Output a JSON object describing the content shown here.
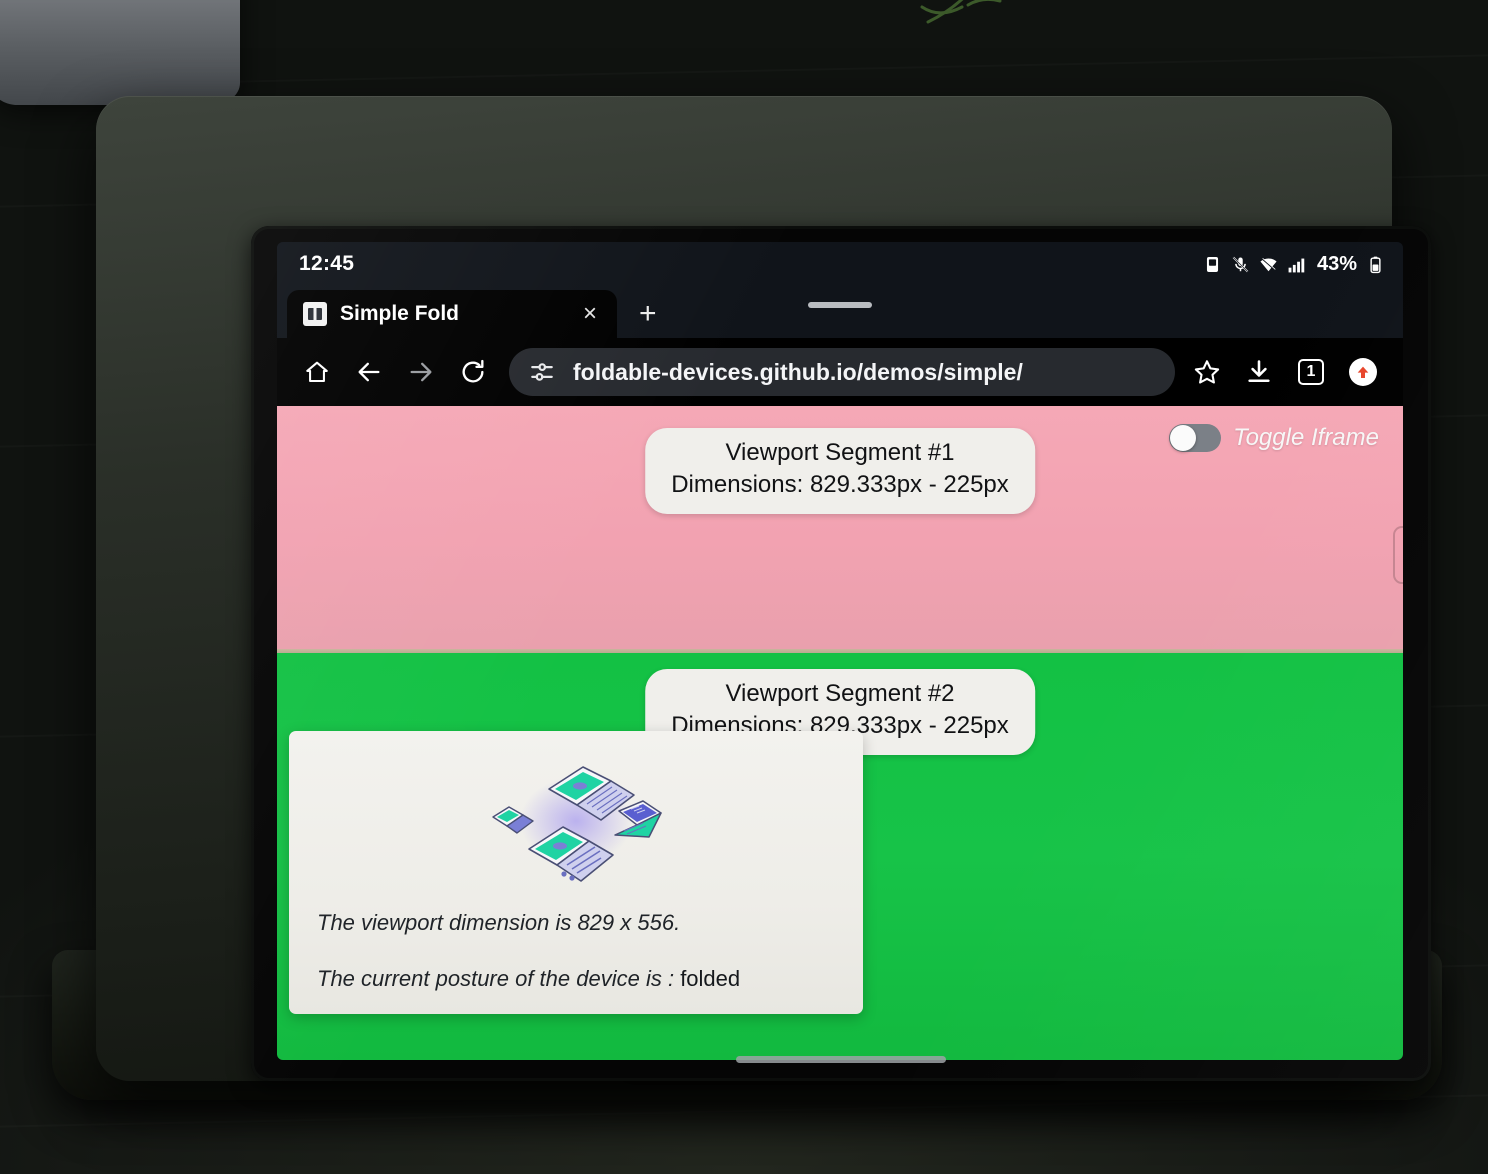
{
  "status_bar": {
    "clock": "12:45",
    "battery_percent": "43%",
    "icons": [
      "screenshot-icon",
      "mic-off-icon",
      "wifi-icon",
      "signal-bars-icon",
      "battery-icon"
    ]
  },
  "browser": {
    "tab": {
      "title": "Simple Fold",
      "favicon_name": "simple-fold-favicon",
      "close_label": "×"
    },
    "new_tab_label": "+",
    "toolbar": {
      "home_label": "home-icon",
      "back_label": "back-arrow-icon",
      "forward_label": "forward-arrow-icon",
      "reload_label": "reload-icon",
      "site_info_label": "site-settings-icon",
      "url": "foldable-devices.github.io/demos/simple/",
      "bookmark_label": "star-icon",
      "download_label": "download-icon",
      "tab_count": "1",
      "profile_label": "update-profile-icon"
    }
  },
  "page": {
    "segment1": {
      "title": "Viewport Segment #1",
      "dimensions": "Dimensions: 829.333px - 225px",
      "background_color": "#f2a2b1"
    },
    "segment2": {
      "title": "Viewport Segment #2",
      "dimensions": "Dimensions: 829.333px - 225px",
      "background_color": "#17c348"
    },
    "toggle": {
      "label": "Toggle Iframe",
      "state": "off"
    },
    "info_card": {
      "illustration_name": "foldable-laptops-illustration",
      "viewport_line": "The viewport dimension is 829 x 556.",
      "posture_prefix": "The current posture of the device is : ",
      "posture_value": "folded"
    }
  },
  "device": {
    "nav_pill_name": "navigation-gesture-pill",
    "tab_handle_name": "tab-strip-drag-handle"
  }
}
